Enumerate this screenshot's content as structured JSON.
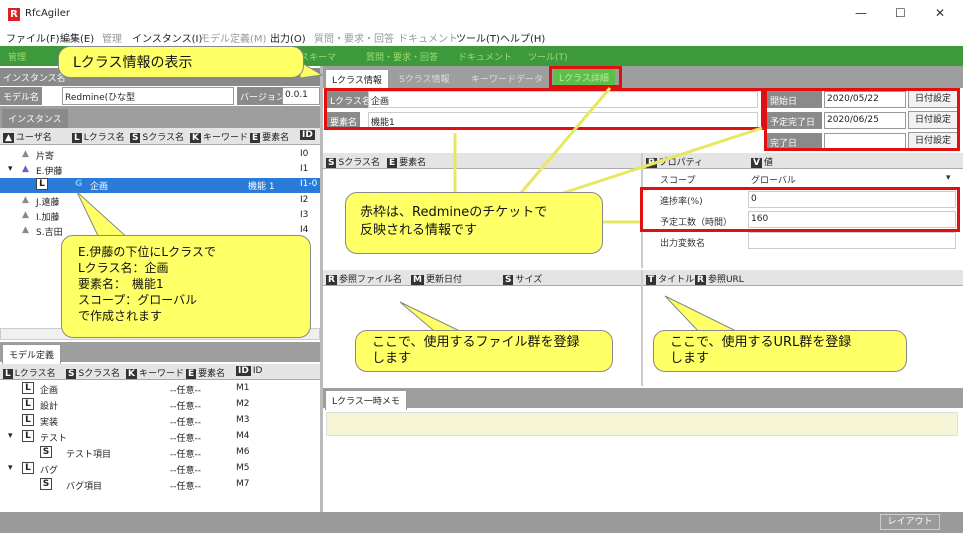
{
  "window": {
    "title": "RfcAgiler",
    "logo_letter": "R",
    "min": "—",
    "max": "☐",
    "close": "✕"
  },
  "menu": [
    "ファイル(F)",
    "編集(E)",
    "管理",
    "インスタンス(I)",
    "モデル定義(M)",
    "出力(O)",
    "質問・要求・回答",
    "ドキュメント",
    "ツール(T)",
    "ヘルプ(H)"
  ],
  "toolbar": [
    "管理",
    "",
    "",
    "",
    "スキーマ",
    "",
    "質問・要求・回答",
    "ドキュメント",
    "ツール(T)"
  ],
  "left": {
    "instance_label": "インスタンス名",
    "model_label": "モデル名",
    "model_value": "Redmine(ひな型",
    "version_label": "バージョン",
    "version_value": "0.0.1",
    "instance_tab": "インスタンス",
    "cols": [
      {
        "chip": "▲",
        "label": "ユーザ名"
      },
      {
        "chip": "L",
        "label": "Lクラス名"
      },
      {
        "chip": "S",
        "label": "Sクラス名"
      },
      {
        "chip": "K",
        "label": "キーワード"
      },
      {
        "chip": "E",
        "label": "要素名"
      },
      {
        "chip": "ID",
        "label": ""
      }
    ],
    "tree": [
      {
        "text": "片寄",
        "id": "I0"
      },
      {
        "text": "E.伊藤",
        "id": "I1"
      },
      {
        "text": "企画",
        "extra": "機能 1",
        "id": "I1-0"
      },
      {
        "text": "J.遠藤",
        "id": "I2"
      },
      {
        "text": "I.加藤",
        "id": "I3"
      },
      {
        "text": "S.吉田",
        "id": "I4"
      }
    ],
    "model_tab": "モデル定義",
    "model_cols": [
      {
        "chip": "L",
        "label": "Lクラス名"
      },
      {
        "chip": "S",
        "label": "Sクラス名"
      },
      {
        "chip": "K",
        "label": "キーワード"
      },
      {
        "chip": "E",
        "label": "要素名"
      },
      {
        "chip": "ID",
        "label": "ID"
      }
    ],
    "model_rows": [
      {
        "badge": "L",
        "name": "企画",
        "kw": "--任意--",
        "id": "M1"
      },
      {
        "badge": "L",
        "name": "設計",
        "kw": "--任意--",
        "id": "M2"
      },
      {
        "badge": "L",
        "name": "実装",
        "kw": "--任意--",
        "id": "M3"
      },
      {
        "badge": "L",
        "name": "テスト",
        "kw": "--任意--",
        "id": "M4"
      },
      {
        "badge": "S",
        "name": "テスト項目",
        "kw": "--任意--",
        "id": "M6"
      },
      {
        "badge": "L",
        "name": "バグ",
        "kw": "--任意--",
        "id": "M5"
      },
      {
        "badge": "S",
        "name": "バグ項目",
        "kw": "--任意--",
        "id": "M7"
      }
    ]
  },
  "right": {
    "tabs": [
      "Lクラス情報",
      "Sクラス情報",
      "キーワードデータ",
      "Lクラス詳細"
    ],
    "lclass_label": "Lクラス名",
    "lclass_value": "企画",
    "element_label": "要素名",
    "element_value": "機能1",
    "start_label": "開始日",
    "start_value": "2020/05/22",
    "due_label": "予定完了日",
    "due_value": "2020/06/25",
    "done_label": "完了日",
    "done_value": "",
    "date_button": "日付設定",
    "sclass_hdr": [
      {
        "chip": "S",
        "label": "Sクラス名"
      },
      {
        "chip": "E",
        "label": "要素名"
      }
    ],
    "prop_hdr": [
      {
        "chip": "P",
        "label": "プロパティ"
      },
      {
        "chip": "V",
        "label": "値"
      }
    ],
    "props": [
      {
        "name": "スコープ",
        "value": "グローバル"
      },
      {
        "name": "進捗率(%)",
        "value": "0"
      },
      {
        "name": "予定工数（時間）",
        "value": "160"
      },
      {
        "name": "出力変数名",
        "value": ""
      }
    ],
    "file_hdr": [
      {
        "chip": "R",
        "label": "参照ファイル名"
      },
      {
        "chip": "M",
        "label": "更新日付"
      },
      {
        "chip": "S",
        "label": "サイズ"
      }
    ],
    "url_hdr": [
      {
        "chip": "T",
        "label": "タイトル"
      },
      {
        "chip": "R",
        "label": "参照URL"
      }
    ],
    "memo_tab": "Lクラス一時メモ"
  },
  "callouts": {
    "top": "Lクラス情報の表示",
    "left": "E.伊藤の下位にLクラスで\nLクラス名：企画\n要素名：　機能1\nスコープ：グローバル\nで作成されます",
    "center": "赤枠は、Redmineのチケットで\n反映される情報です",
    "files": "ここで、使用するファイル群を登録\nします",
    "urls": "ここで、使用するURL群を登録\nします"
  },
  "bottom": {
    "layout_button": "レイアウト"
  },
  "colors": {
    "toolbar": "#3c9a3c",
    "callout": "#ffff66",
    "red_frame": "#e01010",
    "selected_row": "#2a7ad8"
  }
}
